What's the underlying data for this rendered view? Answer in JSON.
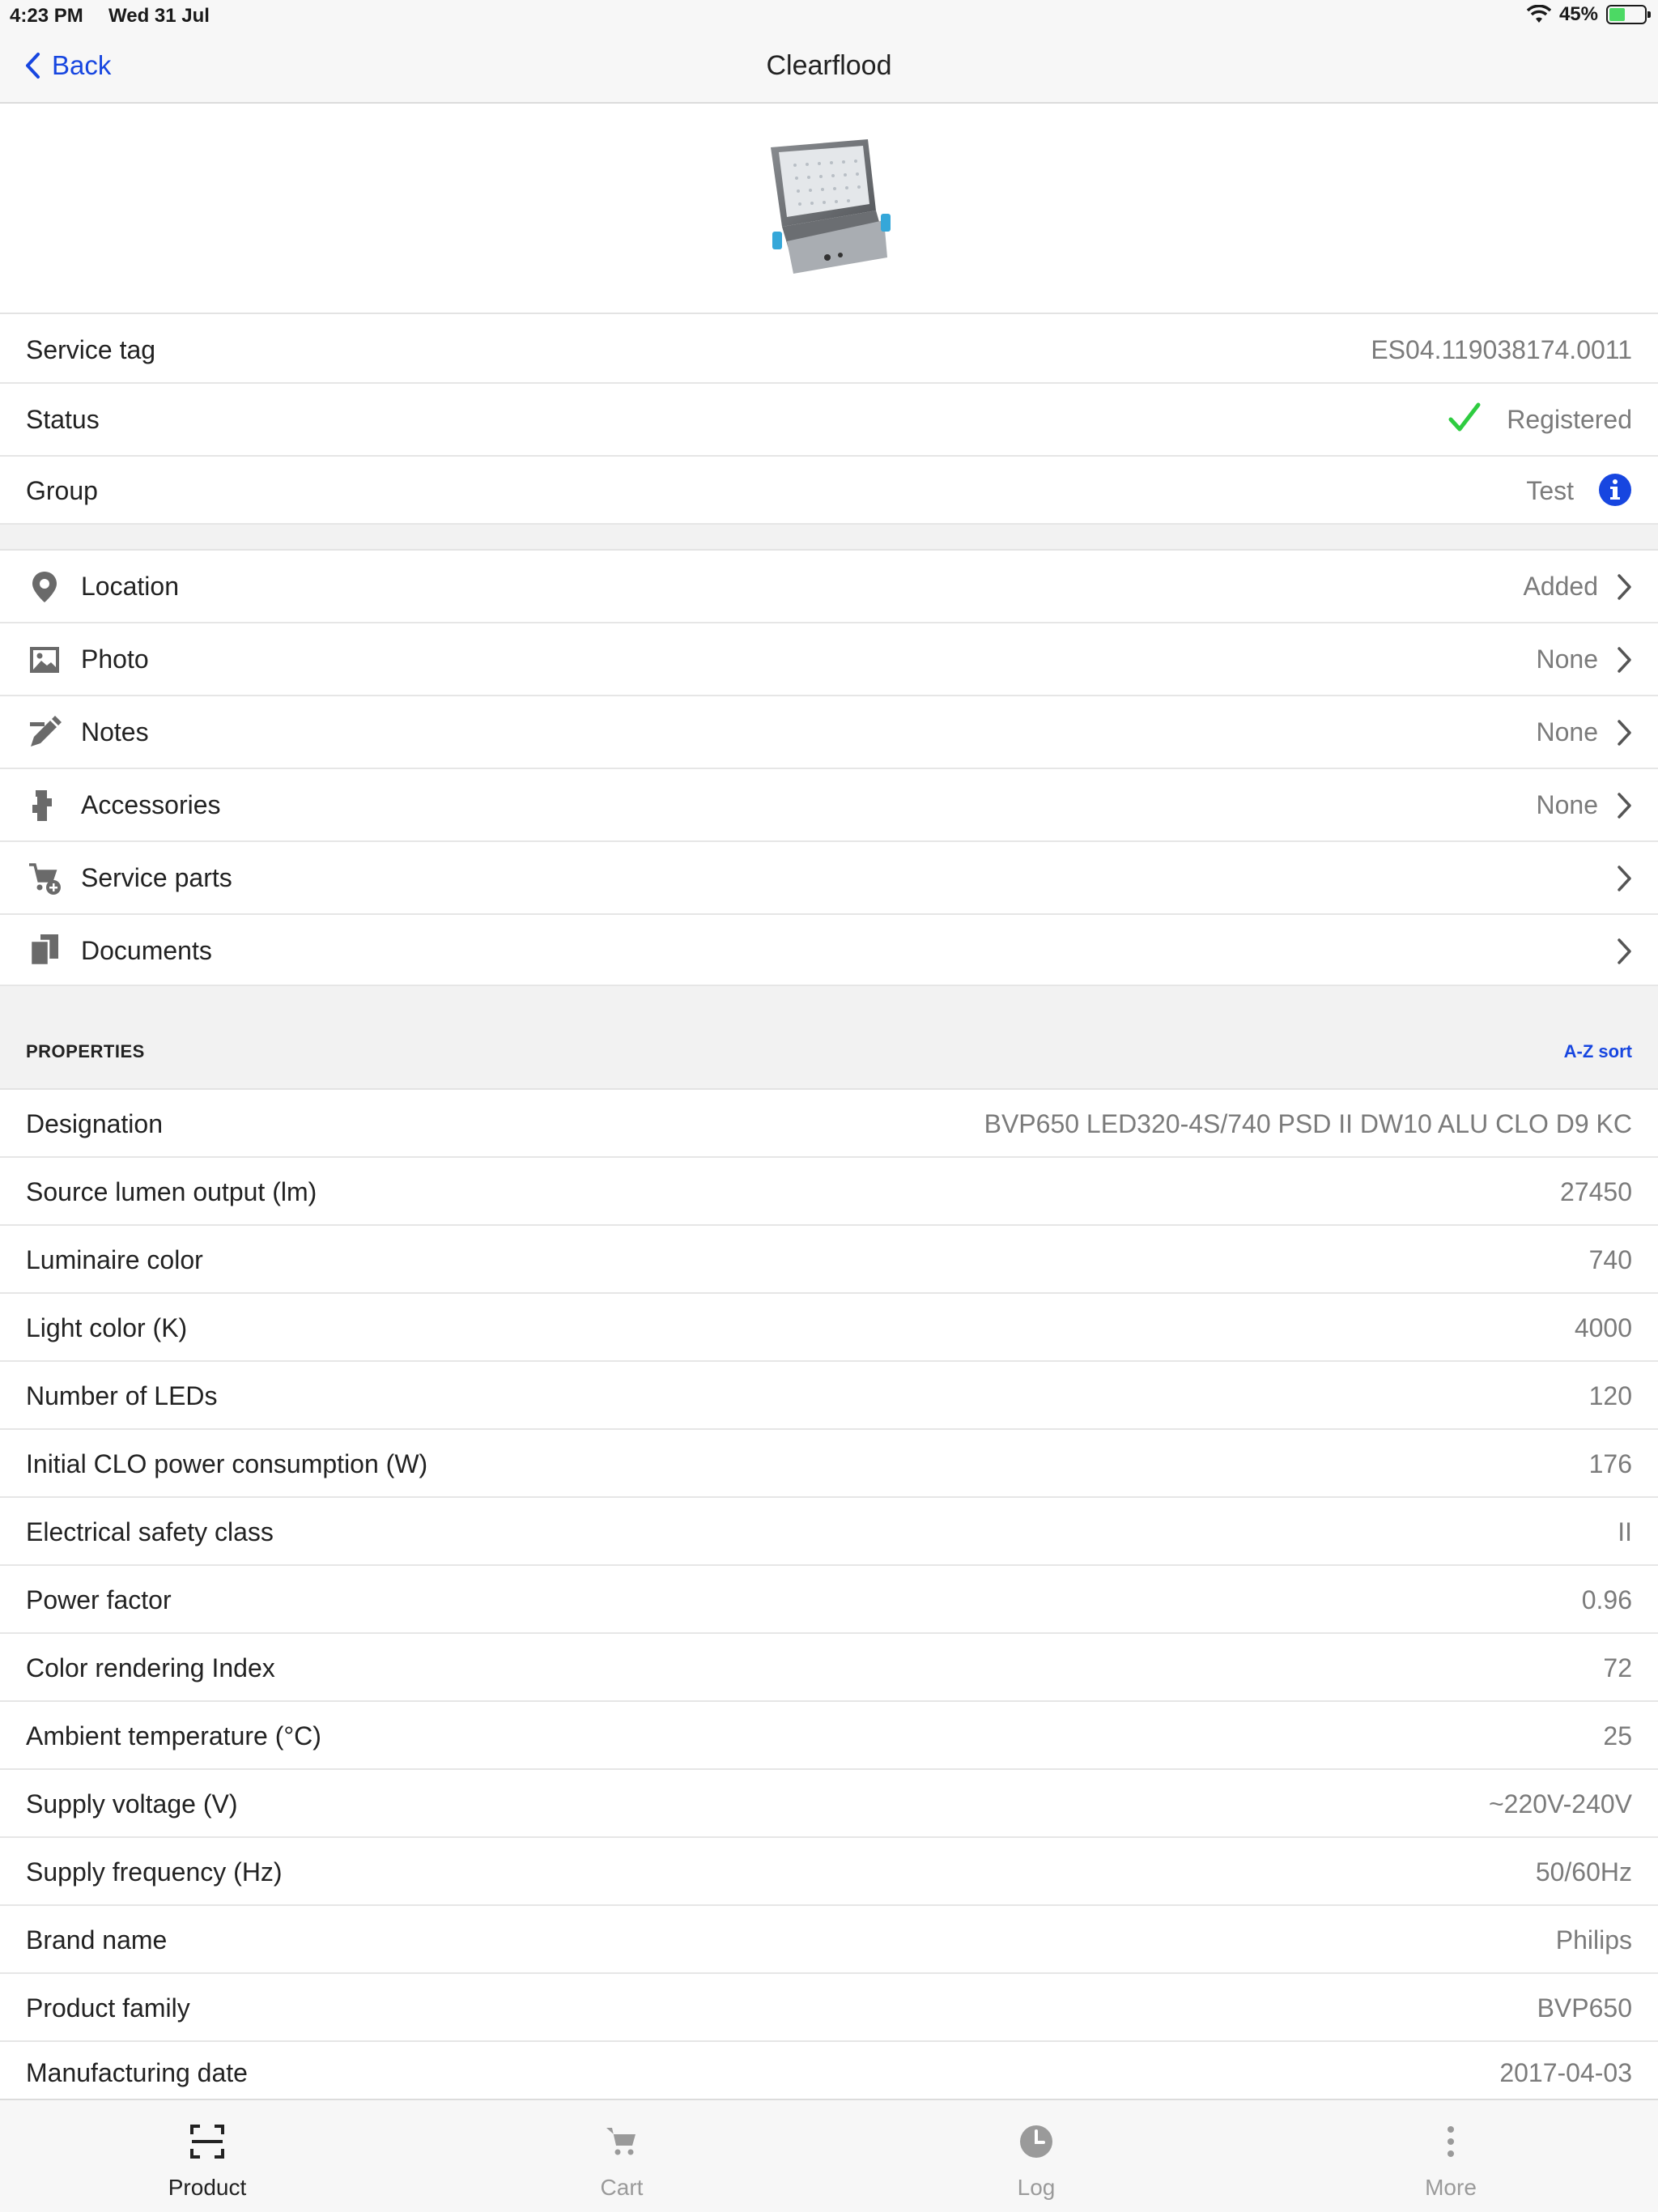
{
  "status_bar": {
    "time": "4:23 PM",
    "date": "Wed 31 Jul",
    "battery": "45%",
    "battery_level": 0.45
  },
  "nav": {
    "back_label": "Back",
    "title": "Clearflood"
  },
  "info_rows": [
    {
      "label": "Service tag",
      "value": "ES04.119038174.0011"
    },
    {
      "label": "Status",
      "value": "Registered"
    },
    {
      "label": "Group",
      "value": "Test"
    }
  ],
  "menu_rows": [
    {
      "label": "Location",
      "value": "Added",
      "icon": "location-pin-icon"
    },
    {
      "label": "Photo",
      "value": "None",
      "icon": "photo-icon"
    },
    {
      "label": "Notes",
      "value": "None",
      "icon": "pencil-icon"
    },
    {
      "label": "Accessories",
      "value": "None",
      "icon": "accessories-icon"
    },
    {
      "label": "Service parts",
      "value": "",
      "icon": "cart-add-icon"
    },
    {
      "label": "Documents",
      "value": "",
      "icon": "documents-icon"
    }
  ],
  "properties": {
    "title": "PROPERTIES",
    "sort_label": "A-Z sort",
    "rows": [
      {
        "label": "Designation",
        "value": "BVP650 LED320-4S/740 PSD II DW10 ALU CLO D9 KC"
      },
      {
        "label": "Source lumen output (lm)",
        "value": "27450"
      },
      {
        "label": "Luminaire color",
        "value": "740"
      },
      {
        "label": "Light color (K)",
        "value": "4000"
      },
      {
        "label": "Number of LEDs",
        "value": "120"
      },
      {
        "label": "Initial CLO power consumption (W)",
        "value": "176"
      },
      {
        "label": "Electrical safety class",
        "value": "II"
      },
      {
        "label": "Power factor",
        "value": "0.96"
      },
      {
        "label": "Color rendering Index",
        "value": "72"
      },
      {
        "label": "Ambient temperature (°C)",
        "value": "25"
      },
      {
        "label": "Supply voltage (V)",
        "value": "~220V-240V"
      },
      {
        "label": "Supply frequency (Hz)",
        "value": "50/60Hz"
      },
      {
        "label": "Brand name",
        "value": "Philips"
      },
      {
        "label": "Product family",
        "value": "BVP650"
      },
      {
        "label": "Manufacturing date",
        "value": "2017-04-03"
      }
    ]
  },
  "tabs": [
    {
      "label": "Product",
      "icon": "scan-icon",
      "active": true
    },
    {
      "label": "Cart",
      "icon": "cart-icon",
      "active": false
    },
    {
      "label": "Log",
      "icon": "clock-icon",
      "active": false
    },
    {
      "label": "More",
      "icon": "more-vertical-icon",
      "active": false
    }
  ],
  "colors": {
    "accent": "#1746e0",
    "success": "#2ecc40",
    "muted_text": "#7b7b7b",
    "background": "#f2f2f2"
  }
}
